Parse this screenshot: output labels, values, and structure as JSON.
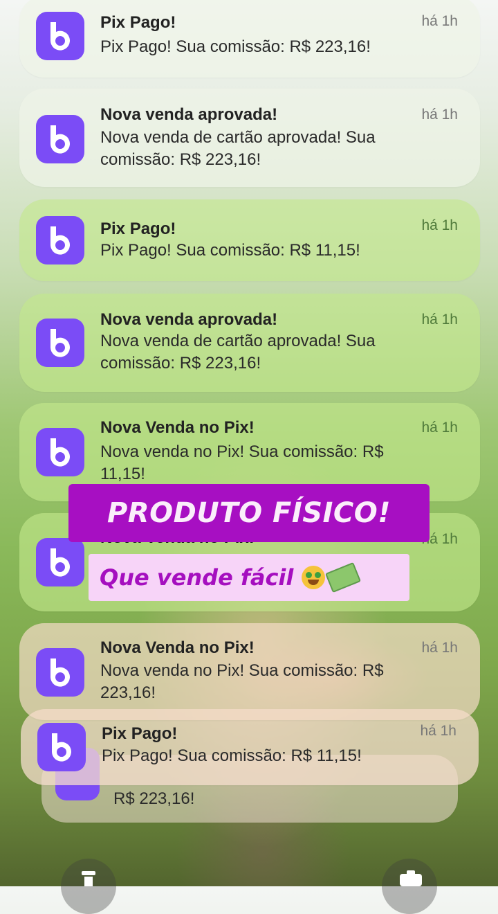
{
  "app": {
    "icon_name": "b-app-icon",
    "icon_color": "#7b4cf6"
  },
  "notifications": [
    {
      "title": "Pix Pago!",
      "body": "Pix Pago! Sua comissão: R$ 223,16!",
      "time": "há 1h"
    },
    {
      "title": "Nova venda aprovada!",
      "body": "Nova venda de cartão aprovada! Sua comissão: R$ 223,16!",
      "time": "há 1h"
    },
    {
      "title": "Pix Pago!",
      "body": "Pix Pago! Sua comissão: R$ 11,15!",
      "time": "há 1h"
    },
    {
      "title": "Nova venda aprovada!",
      "body": "Nova venda de cartão aprovada! Sua comissão: R$ 223,16!",
      "time": "há 1h"
    },
    {
      "title": "Nova Venda no Pix!",
      "body": "Nova venda no Pix! Sua comissão: R$ 11,15!",
      "time": "há 1h"
    },
    {
      "title": "Nova Venda no Pix!",
      "body": "",
      "time": "há 1h"
    },
    {
      "title": "Nova Venda no Pix!",
      "body": "Nova venda no Pix! Sua comissão: R$ 223,16!",
      "time": "há 1h"
    },
    {
      "title": "Pix Pago!",
      "body": "Pix Pago! Sua comissão: R$ 11,15!",
      "time": "há 1h"
    },
    {
      "title": "",
      "body": "R$ 223,16!",
      "time": ""
    }
  ],
  "overlay": {
    "title": "PRODUTO FÍSICO!",
    "subtitle": "Que vende fácil",
    "emojis": [
      "money-mouth-face",
      "money-with-wings"
    ],
    "title_bg": "#a70fc2",
    "subtitle_bg": "#f7d4f8"
  },
  "lockscreen": {
    "left_button": "flashlight-icon",
    "right_button": "camera-icon"
  }
}
